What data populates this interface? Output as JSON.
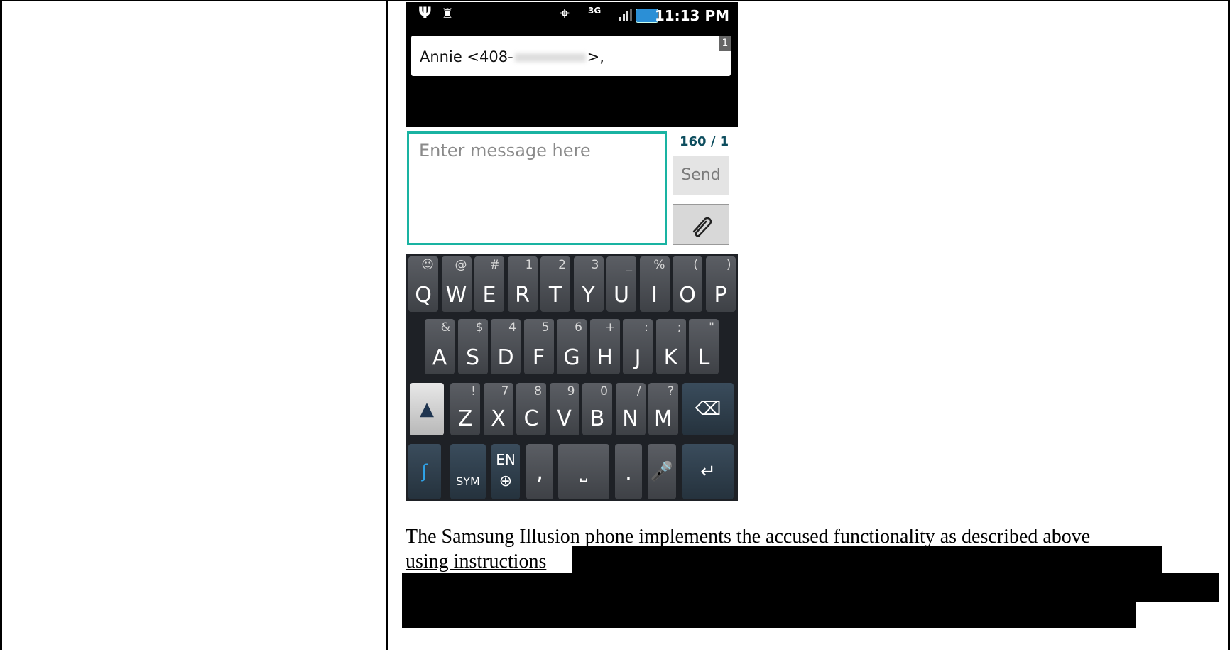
{
  "phone": {
    "status_time": "11:13 PM",
    "network": "3G",
    "recipient_prefix": "Annie <408-",
    "recipient_suffix": ">,",
    "recipient_count": "1",
    "message_placeholder": "Enter message here",
    "char_counter": "160 / 1",
    "send_label": "Send",
    "keyboard": {
      "row1": [
        {
          "main": "Q",
          "sub": "☺"
        },
        {
          "main": "W",
          "sub": "@"
        },
        {
          "main": "E",
          "sub": "#"
        },
        {
          "main": "R",
          "sub": "1"
        },
        {
          "main": "T",
          "sub": "2"
        },
        {
          "main": "Y",
          "sub": "3"
        },
        {
          "main": "U",
          "sub": "_"
        },
        {
          "main": "I",
          "sub": "%"
        },
        {
          "main": "O",
          "sub": "("
        },
        {
          "main": "P",
          "sub": ")"
        }
      ],
      "row2": [
        {
          "main": "A",
          "sub": "&"
        },
        {
          "main": "S",
          "sub": "$"
        },
        {
          "main": "D",
          "sub": "4"
        },
        {
          "main": "F",
          "sub": "5"
        },
        {
          "main": "G",
          "sub": "6"
        },
        {
          "main": "H",
          "sub": "+"
        },
        {
          "main": "J",
          "sub": ":"
        },
        {
          "main": "K",
          "sub": ";"
        },
        {
          "main": "L",
          "sub": "\""
        }
      ],
      "row3": [
        {
          "main": "Z",
          "sub": "!"
        },
        {
          "main": "X",
          "sub": "7"
        },
        {
          "main": "C",
          "sub": "8"
        },
        {
          "main": "V",
          "sub": "9"
        },
        {
          "main": "B",
          "sub": "0"
        },
        {
          "main": "N",
          "sub": "/"
        },
        {
          "main": "M",
          "sub": "?"
        }
      ],
      "sym_label": "SYM",
      "lang_label": "EN",
      "comma_label": ",",
      "period_label": "."
    }
  },
  "caption": {
    "line1": "The Samsung Illusion phone implements the accused functionality as described above",
    "line2": "using instructions"
  },
  "icons": [
    "usb-icon",
    "android-debug-icon",
    "gps-icon",
    "signal-icon",
    "battery-icon",
    "paperclip-icon",
    "shift-icon",
    "backspace-icon",
    "swype-icon",
    "globe-icon",
    "mic-icon",
    "enter-icon"
  ]
}
